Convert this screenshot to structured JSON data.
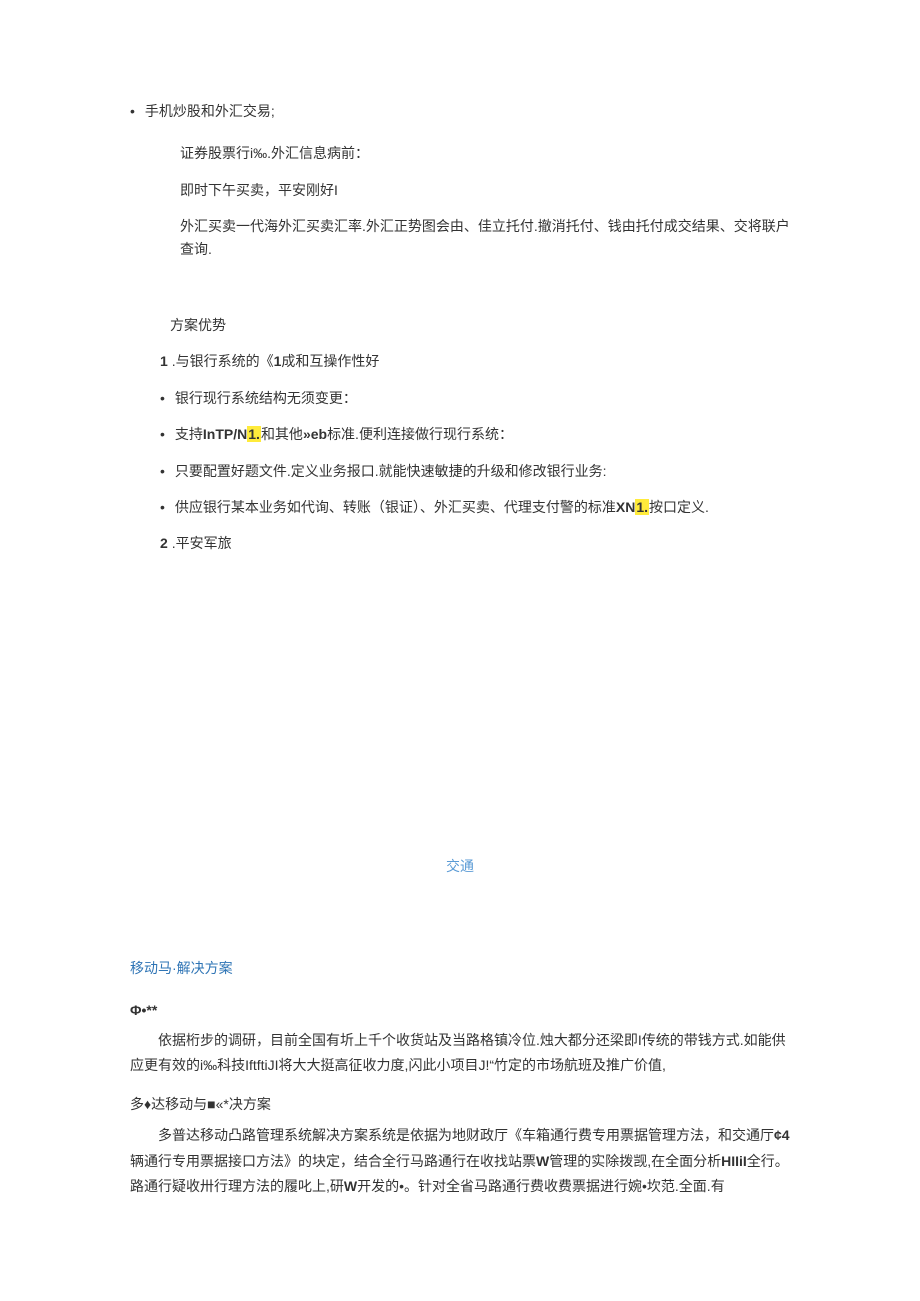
{
  "top_bullet": "手机炒股和外汇交易;",
  "sub_lines": [
    "证券股票行i‰.外汇信息病前：",
    "即时下午买卖，平安刚好I",
    "外汇买卖一代海外汇买卖汇率.外汇正势图会由、佳立托付.撤消托付、钱由托付成交结果、交将联户查询."
  ],
  "advantage_title": "方案优势",
  "num1": {
    "prefix": "1",
    "text": ".与银行系统的《",
    "bold": "1",
    "suffix": "成和互操作性好"
  },
  "adv_items": [
    {
      "text": "银行现行系统结构无须变更："
    },
    {
      "prefix": "支持",
      "bold1": "InTP/N",
      "hl1": "1.",
      "mid": "和其他",
      "bold2": "»eb",
      "suffix": "标准.便利连接做行现行系统："
    },
    {
      "text": "只要配置好题文件.定义业务报口.就能快速敏捷的升级和修改银行业务:"
    },
    {
      "prefix": "供应银行某本业务如代询、转账（银证）、外汇买卖、代理支付警的标准",
      "bold1": "XN",
      "hl1": "1.",
      "suffix": "按口定义."
    }
  ],
  "num2": {
    "prefix": "2",
    "text": ".平安军旅"
  },
  "center_section": "交通",
  "sub_heading": "移动马·解决方案",
  "phi_line": "Φ•**",
  "para1": "依据桁步的调研，目前全国有圻上千个收货站及当路格镇冷位.烛大都分还梁即I传统的带钱方式.如能供应更有效的i‰科技IftftiJI将大大挺高征收力度,闪此小项目J!“竹定的市场航班及推广价值,",
  "section2_title": "多♦达移动与■«*决方案",
  "para2_prefix": "多普达移动凸路管理系统解决方案系统是依据为地财政厅《车箱通行费专用票据管理方法，和交通厅",
  "para2_bold1": "¢4",
  "para2_mid1": "辆通行专用票据接口方法》的块定，结合全行马路通行在收找站票",
  "para2_bold2": "W",
  "para2_mid2": "管理的实除拨觊,在全面分析",
  "para2_bold3": "HIIiI",
  "para2_mid3": "全行。路通行疑收卅行理方法的履叱上,研",
  "para2_bold4": "W",
  "para2_suffix": "开发的•。针对全省马路通行费收费票据进行婉•坎范.全面.有"
}
